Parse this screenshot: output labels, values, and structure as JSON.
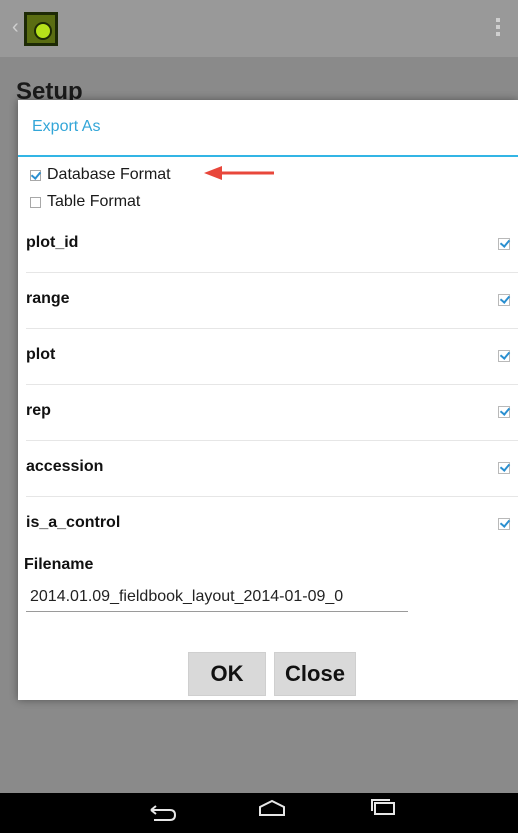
{
  "appbar": {
    "back_glyph": "‹",
    "logo_icon": "fieldbook-logo-icon",
    "overflow_icon": "overflow-menu-icon"
  },
  "background": {
    "setup_title": "Setup"
  },
  "dialog": {
    "title": "Export As",
    "formats": [
      {
        "label": "Database Format",
        "checked": true
      },
      {
        "label": "Table Format",
        "checked": false
      }
    ],
    "fields": [
      {
        "name": "plot_id",
        "checked": true
      },
      {
        "name": "range",
        "checked": true
      },
      {
        "name": "plot",
        "checked": true
      },
      {
        "name": "rep",
        "checked": true
      },
      {
        "name": "accession",
        "checked": true
      },
      {
        "name": "is_a_control",
        "checked": true
      }
    ],
    "filename_label": "Filename",
    "filename_value": "2014.01.09_fieldbook_layout_2014-01-09_0",
    "ok_label": "OK",
    "close_label": "Close"
  },
  "annotation": {
    "arrow_color": "#e8473b"
  },
  "navbar": {
    "back_glyph": "⮌",
    "home_icon": "home-icon",
    "recent_icon": "recent-apps-icon"
  }
}
